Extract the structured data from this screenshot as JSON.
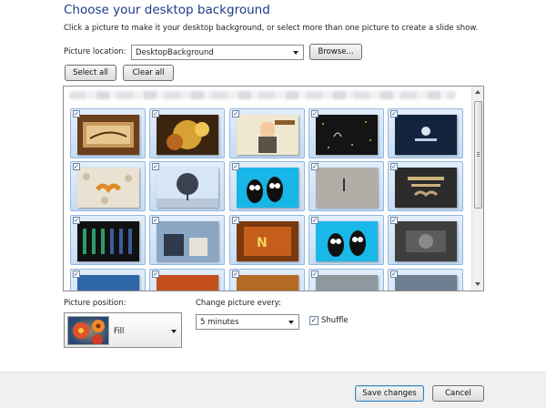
{
  "header": {
    "title": "Choose your desktop background",
    "subtitle": "Click a picture to make it your desktop background, or select more than one picture to create a slide show."
  },
  "location": {
    "label": "Picture location:",
    "value": "DesktopBackground",
    "browse_label": "Browse..."
  },
  "selection": {
    "select_all_label": "Select all",
    "clear_all_label": "Clear all"
  },
  "gallery": {
    "check_glyph": "✓",
    "thumbnails": [
      {
        "name": "harvest",
        "checked": true
      },
      {
        "name": "autumn-leaves",
        "checked": true
      },
      {
        "name": "november-character",
        "checked": true
      },
      {
        "name": "dark-night",
        "checked": true
      },
      {
        "name": "dark-blue-logo",
        "checked": true
      },
      {
        "name": "mustache-pattern",
        "checked": true
      },
      {
        "name": "bare-tree",
        "checked": true
      },
      {
        "name": "penguins-cyan",
        "checked": true
      },
      {
        "name": "foggy-lighthouse",
        "checked": true
      },
      {
        "name": "mustache-movember",
        "checked": true
      },
      {
        "name": "dark-pattern",
        "checked": true
      },
      {
        "name": "street-scene",
        "checked": true
      },
      {
        "name": "orange-nov",
        "checked": true
      },
      {
        "name": "penguins-cyan-2",
        "checked": true
      },
      {
        "name": "grunge-gray",
        "checked": true
      },
      {
        "name": "blue-partial",
        "checked": true
      },
      {
        "name": "orange-partial",
        "checked": true
      },
      {
        "name": "autumn-partial",
        "checked": true
      },
      {
        "name": "gray-partial",
        "checked": true
      },
      {
        "name": "blue-gray-partial",
        "checked": true
      }
    ]
  },
  "position": {
    "label": "Picture position:",
    "value": "Fill"
  },
  "interval": {
    "label": "Change picture every:",
    "value": "5 minutes"
  },
  "shuffle": {
    "label": "Shuffle",
    "checked": true,
    "check_glyph": "✓"
  },
  "footer": {
    "save_label": "Save changes",
    "cancel_label": "Cancel"
  },
  "colors": {
    "title": "#1e3a8a",
    "tile_border": "#93b7e0",
    "tile_fill": "#d6e6f7"
  }
}
